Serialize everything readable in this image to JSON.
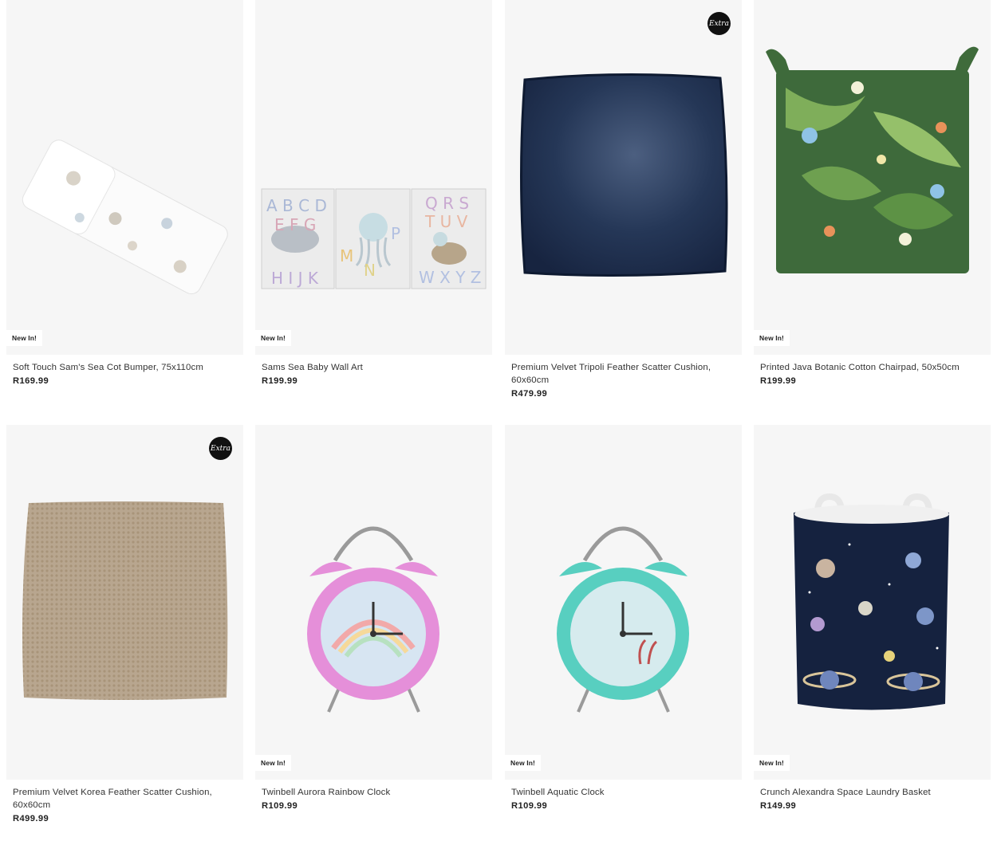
{
  "products": [
    {
      "name": "Soft Touch Sam's Sea Cot Bumper, 75x110cm",
      "price": "R169.99",
      "badge": "New In!",
      "extra": false,
      "image": "cot-bumper-image"
    },
    {
      "name": "Sams Sea Baby Wall Art",
      "price": "R199.99",
      "badge": "New In!",
      "extra": false,
      "image": "wall-art-image"
    },
    {
      "name": "Premium Velvet Tripoli Feather Scatter Cushion, 60x60cm",
      "price": "R479.99",
      "badge": "",
      "extra": true,
      "image": "navy-cushion-image"
    },
    {
      "name": "Printed Java Botanic Cotton Chairpad, 50x50cm",
      "price": "R199.99",
      "badge": "New In!",
      "extra": false,
      "image": "botanic-chairpad-image"
    },
    {
      "name": "Premium Velvet Korea Feather Scatter Cushion, 60x60cm",
      "price": "R499.99",
      "badge": "",
      "extra": true,
      "image": "beige-cushion-image"
    },
    {
      "name": "Twinbell Aurora Rainbow Clock",
      "price": "R109.99",
      "badge": "New In!",
      "extra": false,
      "image": "pink-clock-image"
    },
    {
      "name": "Twinbell Aquatic Clock",
      "price": "R109.99",
      "badge": "New In!",
      "extra": false,
      "image": "teal-clock-image"
    },
    {
      "name": "Crunch Alexandra Space Laundry Basket",
      "price": "R149.99",
      "badge": "New In!",
      "extra": false,
      "image": "space-basket-image"
    }
  ],
  "extra_badge_text": "Extra",
  "colors": {
    "card_bg": "#f6f6f6",
    "badge_bg": "#ffffff",
    "extra_badge_bg": "#111111",
    "navy": "#1f2f4d",
    "botanic": "#3e6a3b",
    "beige": "#b9a68e",
    "pink": "#e58fd9",
    "teal": "#58cfc0",
    "space": "#15223f"
  }
}
